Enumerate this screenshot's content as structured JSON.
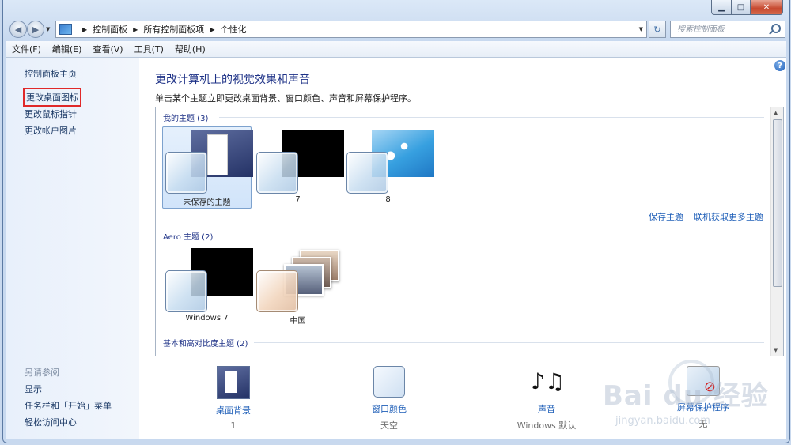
{
  "window": {
    "caption": {
      "minimize": "▁",
      "maximize": "□",
      "close": "✕"
    }
  },
  "nav": {
    "back": "◀",
    "forward": "▶",
    "breadcrumbs": [
      "控制面板",
      "所有控制面板项",
      "个性化"
    ],
    "refresh": "↻",
    "search_placeholder": "搜索控制面板"
  },
  "menu": [
    "文件(F)",
    "编辑(E)",
    "查看(V)",
    "工具(T)",
    "帮助(H)"
  ],
  "sidebar": {
    "links": [
      "控制面板主页",
      "更改桌面图标",
      "更改鼠标指针",
      "更改帐户图片"
    ],
    "see_also_title": "另请参阅",
    "see_also": [
      "显示",
      "任务栏和「开始」菜单",
      "轻松访问中心"
    ]
  },
  "content": {
    "help": "?",
    "title": "更改计算机上的视觉效果和声音",
    "subtitle": "单击某个主题立即更改桌面背景、窗口颜色、声音和屏幕保护程序。",
    "groups": [
      {
        "title": "我的主题 (3)"
      },
      {
        "title": "Aero 主题 (2)"
      },
      {
        "title": "基本和高对比度主题 (2)"
      }
    ],
    "my_themes": [
      "未保存的主题",
      "7",
      "8"
    ],
    "aero_themes": [
      "Windows 7",
      "中国"
    ],
    "links": {
      "save": "保存主题",
      "more": "联机获取更多主题"
    }
  },
  "settings": [
    {
      "label": "桌面背景",
      "value": "1"
    },
    {
      "label": "窗口颜色",
      "value": "天空"
    },
    {
      "label": "声音",
      "value": "Windows 默认"
    },
    {
      "label": "屏幕保护程序",
      "value": "无"
    }
  ],
  "icons": {
    "sound": "♪♫"
  },
  "watermark": {
    "main": "Bai du 经验",
    "sub": "jingyan.baidu.com"
  },
  "colors": {
    "link": "#1f5fb8",
    "title": "#1e3287",
    "highlight_box": "#e02929"
  }
}
